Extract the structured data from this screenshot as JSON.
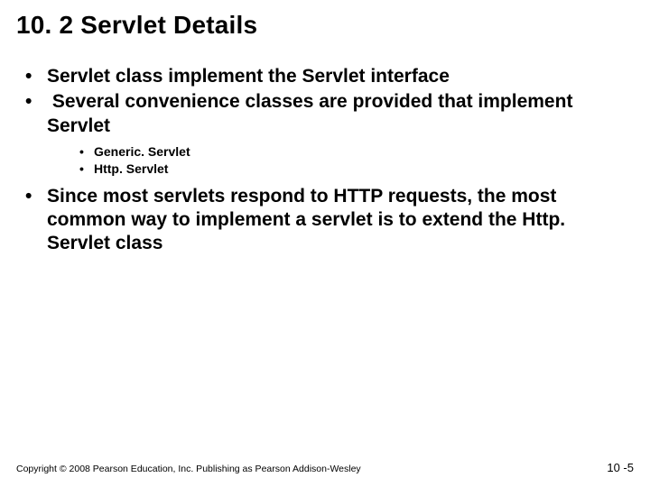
{
  "title": "10. 2 Servlet Details",
  "bullets": {
    "b1": "Servlet class implement the Servlet interface",
    "b2": "Several convenience classes are provided that implement Servlet",
    "b2_sub": {
      "s1": "Generic. Servlet",
      "s2": "Http. Servlet"
    },
    "b3": "Since most servlets respond to HTTP requests, the most common way to implement a servlet is to extend the Http. Servlet class"
  },
  "footer": {
    "copyright": "Copyright © 2008 Pearson Education, Inc. Publishing as Pearson Addison-Wesley",
    "page": "10 -5"
  }
}
